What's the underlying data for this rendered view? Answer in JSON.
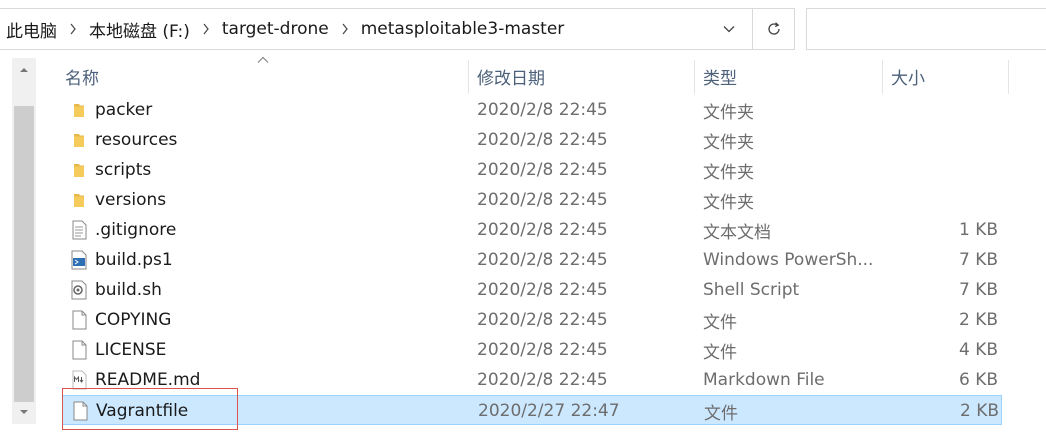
{
  "breadcrumb": [
    "此电脑",
    "本地磁盘 (F:)",
    "target-drone",
    "metasploitable3-master"
  ],
  "columns": {
    "name": "名称",
    "date": "修改日期",
    "type": "类型",
    "size": "大小"
  },
  "files": [
    {
      "name": "packer",
      "date": "2020/2/8 22:45",
      "type": "文件夹",
      "size": "",
      "icon": "folder-icon"
    },
    {
      "name": "resources",
      "date": "2020/2/8 22:45",
      "type": "文件夹",
      "size": "",
      "icon": "folder-icon"
    },
    {
      "name": "scripts",
      "date": "2020/2/8 22:45",
      "type": "文件夹",
      "size": "",
      "icon": "folder-icon"
    },
    {
      "name": "versions",
      "date": "2020/2/8 22:45",
      "type": "文件夹",
      "size": "",
      "icon": "folder-icon"
    },
    {
      "name": ".gitignore",
      "date": "2020/2/8 22:45",
      "type": "文本文档",
      "size": "1 KB",
      "icon": "text-file-icon"
    },
    {
      "name": "build.ps1",
      "date": "2020/2/8 22:45",
      "type": "Windows PowerSh...",
      "size": "7 KB",
      "icon": "powershell-file-icon"
    },
    {
      "name": "build.sh",
      "date": "2020/2/8 22:45",
      "type": "Shell Script",
      "size": "7 KB",
      "icon": "shell-script-icon"
    },
    {
      "name": "COPYING",
      "date": "2020/2/8 22:45",
      "type": "文件",
      "size": "2 KB",
      "icon": "blank-file-icon"
    },
    {
      "name": "LICENSE",
      "date": "2020/2/8 22:45",
      "type": "文件",
      "size": "4 KB",
      "icon": "blank-file-icon"
    },
    {
      "name": "README.md",
      "date": "2020/2/8 22:45",
      "type": "Markdown File",
      "size": "6 KB",
      "icon": "markdown-file-icon"
    },
    {
      "name": "Vagrantfile",
      "date": "2020/2/27 22:47",
      "type": "文件",
      "size": "2 KB",
      "icon": "blank-file-icon",
      "selected": true
    }
  ],
  "colors": {
    "selection_bg": "#cce8ff",
    "selection_border": "#99d1ff",
    "highlight_box": "#d9534f",
    "header_text": "#4c607a",
    "folder": "#e8b84a"
  }
}
